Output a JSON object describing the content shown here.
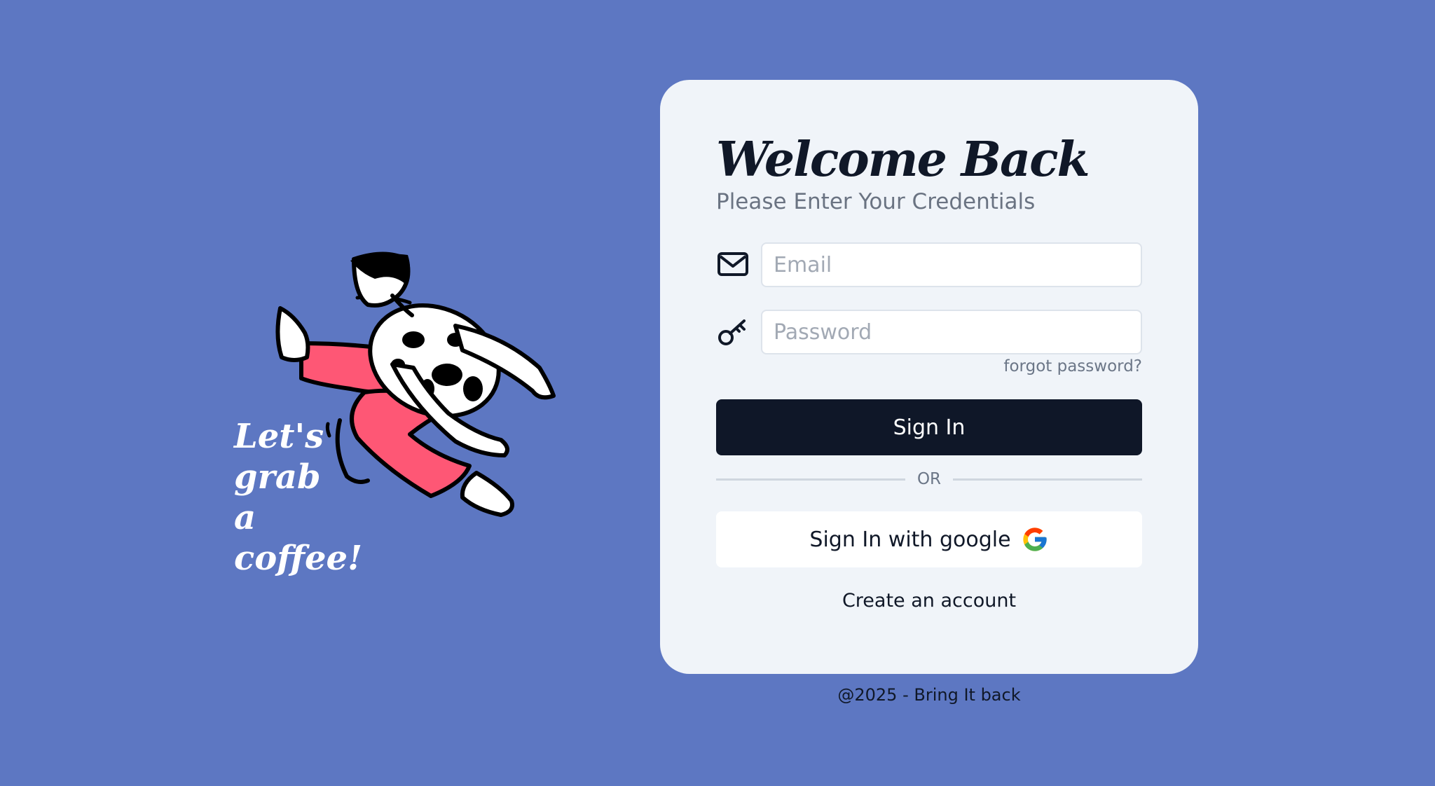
{
  "hero": {
    "caption_lines": [
      "Let's",
      "grab",
      "a coffee!"
    ],
    "illustration": "jumping-person-illustration"
  },
  "login": {
    "title": "Welcome Back",
    "subtitle": "Please Enter Your Credentials",
    "email": {
      "placeholder": "Email",
      "value": "",
      "icon": "mail-icon"
    },
    "password": {
      "placeholder": "Password",
      "value": "",
      "icon": "key-icon"
    },
    "forgot_label": "forgot password?",
    "signin_label": "Sign In",
    "divider_label": "OR",
    "google_label": "Sign In with google",
    "google_icon": "google-icon",
    "create_account_label": "Create an account"
  },
  "footer": {
    "text": "@2025 - Bring It back"
  },
  "colors": {
    "background": "#5d77c2",
    "card": "#f0f4f9",
    "primary": "#0f1728",
    "accent_pants": "#fe5775"
  }
}
